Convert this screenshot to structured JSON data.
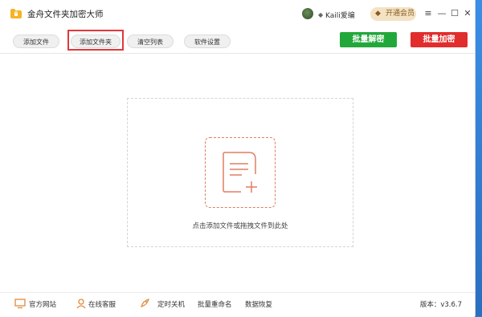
{
  "app": {
    "title": "金舟文件夹加密大师"
  },
  "user": {
    "name": "Kaili爱编"
  },
  "header": {
    "vip_label": "开通会员",
    "vip_icon": "diamond-icon"
  },
  "window_controls": {
    "menu": "≡",
    "minimize": "—",
    "maximize": "☐",
    "close": "✕"
  },
  "toolbar": {
    "add_file": "添加文件",
    "add_folder": "添加文件夹",
    "clear_list": "清空列表",
    "settings": "软件设置",
    "bulk_decrypt": "批量解密",
    "bulk_encrypt": "批量加密"
  },
  "colors": {
    "decrypt": "#22a83a",
    "encrypt": "#e12d2d",
    "accent": "#e07e63",
    "highlight": "#e0393b"
  },
  "dropzone": {
    "hint": "点击添加文件或拖拽文件到此处"
  },
  "statusbar": {
    "website": "官方网站",
    "support": "在线客服",
    "shutdown": "定时关机",
    "rename": "批量重命名",
    "recovery": "数据恢复",
    "version": "版本：v3.6.7"
  }
}
